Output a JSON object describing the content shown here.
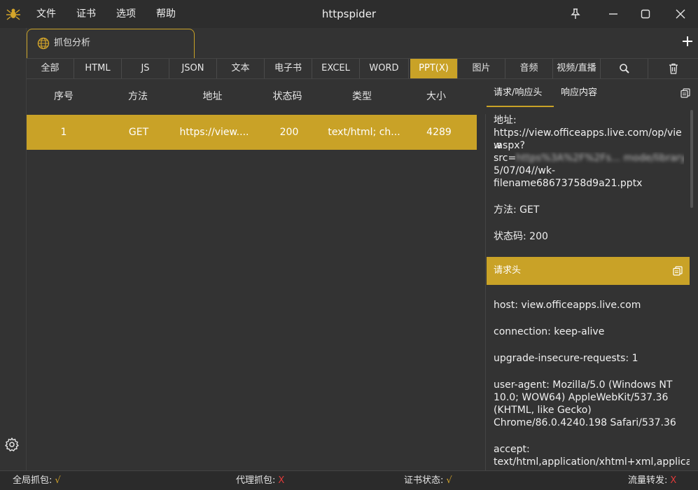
{
  "titlebar": {
    "title": "httpspider",
    "menu": [
      "文件",
      "证书",
      "选项",
      "帮助"
    ]
  },
  "tabs": {
    "main_tab": "抓包分析"
  },
  "filters": [
    "全部",
    "HTML",
    "JS",
    "JSON",
    "文本",
    "电子书",
    "EXCEL",
    "WORD",
    "PPT(X)",
    "图片",
    "音频",
    "视频/直播"
  ],
  "active_filter": "PPT(X)",
  "table": {
    "columns": [
      "序号",
      "方法",
      "地址",
      "状态码",
      "类型",
      "大小"
    ],
    "rows": [
      {
        "index": "1",
        "method": "GET",
        "url": "https://view....",
        "status": "200",
        "type": "text/html; ch...",
        "size": "4289"
      }
    ]
  },
  "panel": {
    "tabs": [
      "请求/响应头",
      "响应内容"
    ],
    "url_label": "地址:",
    "url_line1": "https://view.officeapps.live.com/op/view",
    "url_line2": ".aspx?",
    "url_line3_prefix": "src=",
    "url_line3_blur": "https%3A%2F%2Fs... mode/library/",
    "url_line3_suffix": "202",
    "url_line4": "5/07/04//wk-",
    "url_line5": "filename68673758d9a21.pptx",
    "method": "方法: GET",
    "status": "状态码: 200",
    "request_headers_title": "请求头",
    "headers": {
      "host": "host: view.officeapps.live.com",
      "connection": "connection: keep-alive",
      "upgrade": "upgrade-insecure-requests: 1",
      "ua1": "user-agent: Mozilla/5.0 (Windows NT",
      "ua2": "10.0; WOW64) AppleWebKit/537.36",
      "ua3": "(KHTML, like Gecko)",
      "ua4": "Chrome/86.0.4240.198 Safari/537.36",
      "accept1": "accept:",
      "accept2": "text/html,application/xhtml+xml,applica"
    }
  },
  "status": {
    "global_capture_label": "全局抓包:",
    "global_capture_value": "√",
    "proxy_capture_label": "代理抓包:",
    "proxy_capture_value": "X",
    "cert_status_label": "证书状态:",
    "cert_status_value": "√",
    "traffic_forward_label": "流量转发:",
    "traffic_forward_value": "X"
  },
  "colors": {
    "accent": "#c9a227",
    "background": "#333333",
    "ok": "#d4a52a",
    "bad": "#e03a3a"
  },
  "icons": [
    "spider-icon",
    "pin-icon",
    "minimize-icon",
    "maximize-icon",
    "close-icon",
    "globe-icon",
    "plus-icon",
    "search-icon",
    "trash-icon",
    "copy-icon",
    "gear-icon"
  ]
}
